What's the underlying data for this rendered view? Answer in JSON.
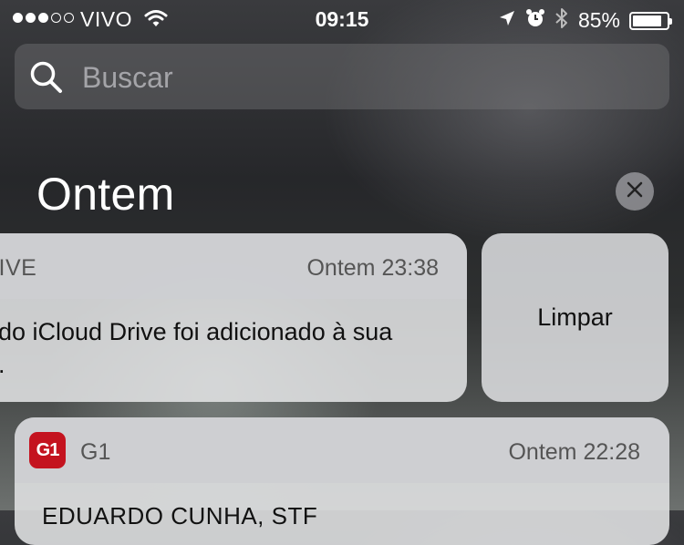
{
  "status_bar": {
    "signal_filled": 3,
    "signal_total": 5,
    "carrier": "VIVO",
    "time": "09:15",
    "battery_percent": "85%",
    "battery_level": 0.85,
    "icons": [
      "wifi-icon",
      "location-arrow-icon",
      "alarm-clock-icon",
      "bluetooth-icon",
      "battery-icon"
    ]
  },
  "search": {
    "placeholder": "Buscar",
    "icon": "search-icon"
  },
  "section": {
    "title": "Ontem",
    "close_icon": "close-icon"
  },
  "notifications": [
    {
      "app": "RIVE",
      "time": "Ontem 23:38",
      "body_line1": "do iCloud Drive foi adicionado à sua",
      "body_line2": "."
    },
    {
      "app": "G1",
      "app_icon_text": "G1",
      "app_icon_color": "#c4131f",
      "time": "Ontem 22:28",
      "body_line1": "EDUARDO CUNHA, STF"
    }
  ],
  "actions": {
    "clear_label": "Limpar"
  }
}
